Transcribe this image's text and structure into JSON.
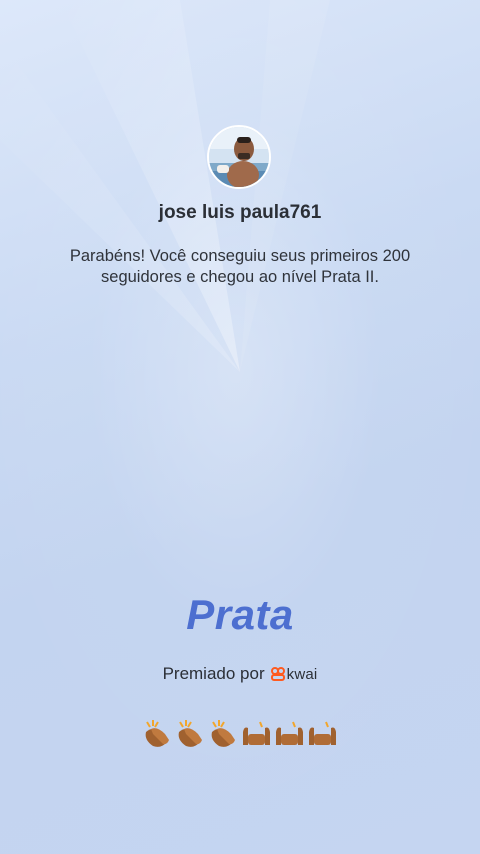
{
  "profile": {
    "avatar_icon": "user-avatar-photo",
    "username": "jose luis paula761"
  },
  "congrats": {
    "message": "Parabéns! Você conseguiu seus primeiros 200 seguidores e chegou ao nível Prata II."
  },
  "badge": {
    "level_name": "Prata",
    "level_color": "#4d6fd0"
  },
  "awarded": {
    "label": "Premiado por",
    "brand": "kwai",
    "brand_icon": "kwai-logo-icon",
    "brand_color": "#ff5a1f"
  },
  "reactions": {
    "icons": [
      "clapping-hands-icon",
      "clapping-hands-icon",
      "clapping-hands-icon",
      "raising-hands-icon",
      "raising-hands-icon",
      "raising-hands-icon"
    ]
  }
}
